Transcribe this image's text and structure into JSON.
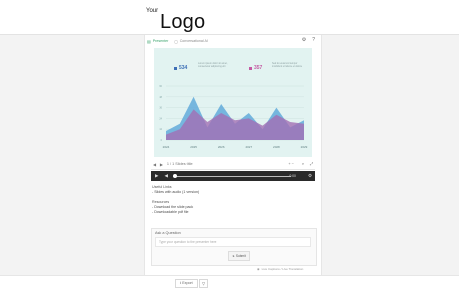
{
  "header": {
    "logo_small": "Your",
    "logo_big": "Logo"
  },
  "tabs": [
    {
      "label": "Presenter",
      "active": true,
      "icon": "presentation-icon"
    },
    {
      "label": "Conversational AI",
      "active": false,
      "icon": "chat-icon"
    }
  ],
  "tab_tools": {
    "settings_icon": "⚙",
    "help_icon": "?"
  },
  "visual": {
    "stat_left": {
      "value": "534",
      "color": "#3d6fb6",
      "desc": "Lorem ipsum dolor sit amet, consectetur adipiscing elit"
    },
    "stat_right": {
      "value": "357",
      "color": "#c45aa3",
      "desc": "Sed do eiusmod tempor incididunt ut labore et dolore"
    }
  },
  "chart_data": {
    "type": "area",
    "categories": [
      "2024",
      "2025",
      "2026",
      "2027",
      "2028",
      "2029"
    ],
    "series": [
      {
        "values": [
          10,
          18,
          48,
          14,
          40,
          18,
          30,
          12,
          36,
          14,
          22
        ],
        "color": "#5aa6d9"
      },
      {
        "values": [
          6,
          12,
          34,
          20,
          30,
          22,
          24,
          16,
          28,
          20,
          18
        ],
        "color": "#a36fb4"
      }
    ],
    "ylim": [
      0,
      60
    ]
  },
  "controls": {
    "page_label": "1 / 1 Slides title",
    "zoom_label": "+ −"
  },
  "player": {
    "play_icon": "▶",
    "volume_icon": "◀",
    "time_label": "0:00"
  },
  "info": {
    "files_heading": "Useful Links",
    "files": [
      "- Slides with audio (1 version)"
    ],
    "resources_heading": "Resources",
    "resources": [
      "- Download the slide pack",
      "- Downloadable pdf file"
    ]
  },
  "ask": {
    "title": "Ask a Question",
    "placeholder": "Type your question to the presenter here",
    "submit": "Submit"
  },
  "footer_note": "Live Captions / Live Translation",
  "bottom": {
    "export_label": "Export",
    "more_icon": "▽"
  }
}
